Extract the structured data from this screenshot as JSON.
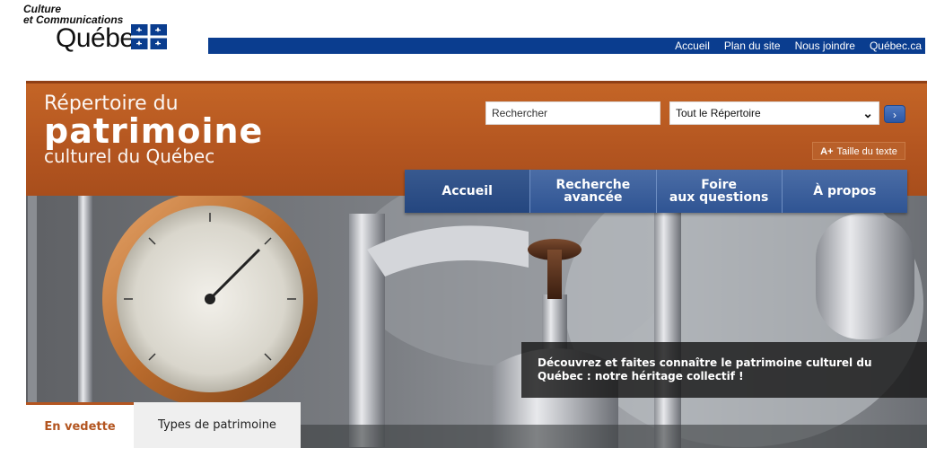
{
  "gov": {
    "logo_line1": "Culture",
    "logo_line2": "et Communications",
    "logo_wordmark": "Québec",
    "links": [
      "Accueil",
      "Plan du site",
      "Nous joindre",
      "Québec.ca"
    ]
  },
  "site": {
    "title_line1": "Répertoire du",
    "title_line2": "patrimoine",
    "title_line3": "culturel du Québec"
  },
  "search": {
    "placeholder": "Rechercher",
    "scope_selected": "Tout le Répertoire",
    "go_icon": "chevron-right-icon"
  },
  "text_size": {
    "prefix": "A+",
    "label": "Taille du texte"
  },
  "nav": {
    "items": [
      {
        "line1": "Accueil",
        "line2": ""
      },
      {
        "line1": "Recherche",
        "line2": "avancée"
      },
      {
        "line1": "Foire",
        "line2": "aux questions"
      },
      {
        "line1": "À propos",
        "line2": ""
      }
    ]
  },
  "hero": {
    "caption": "Découvrez et faites connaître le patrimoine culturel du Québec : notre héritage collectif !"
  },
  "tabs": {
    "featured": "En vedette",
    "types": "Types de patrimoine"
  },
  "colors": {
    "gov_blue": "#0a3d8f",
    "banner_orange": "#b35520",
    "nav_blue": "#2f5493"
  }
}
